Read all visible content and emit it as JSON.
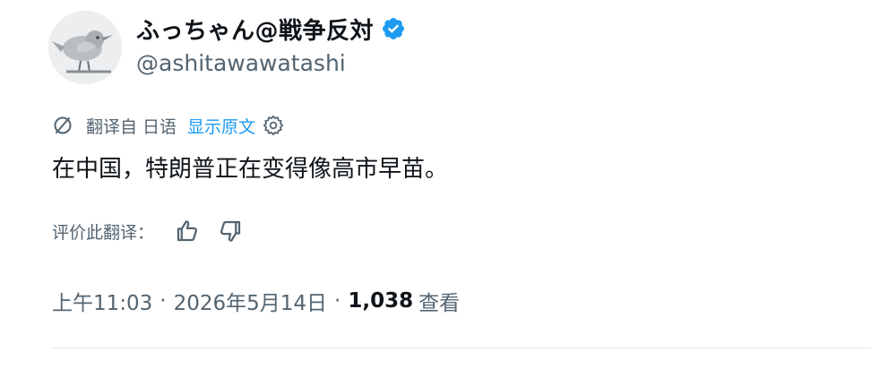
{
  "author": {
    "display_name": "ふっちゃん@戦争反対",
    "handle": "@ashitawawatashi",
    "verified": true,
    "avatar_icon": "bird-avatar-icon"
  },
  "translation": {
    "label": "翻译自 日语",
    "show_original": "显示原文"
  },
  "tweet": {
    "text": "在中国，特朗普正在变得像高市早苗。"
  },
  "rating": {
    "label": "评价此翻译："
  },
  "meta": {
    "time": "上午11:03",
    "date": "2026年5月14日",
    "separator": "·",
    "views_count": "1,038",
    "views_label": "查看"
  },
  "colors": {
    "accent": "#1d9bf0",
    "secondary_text": "#536471",
    "primary_text": "#0f1419"
  }
}
